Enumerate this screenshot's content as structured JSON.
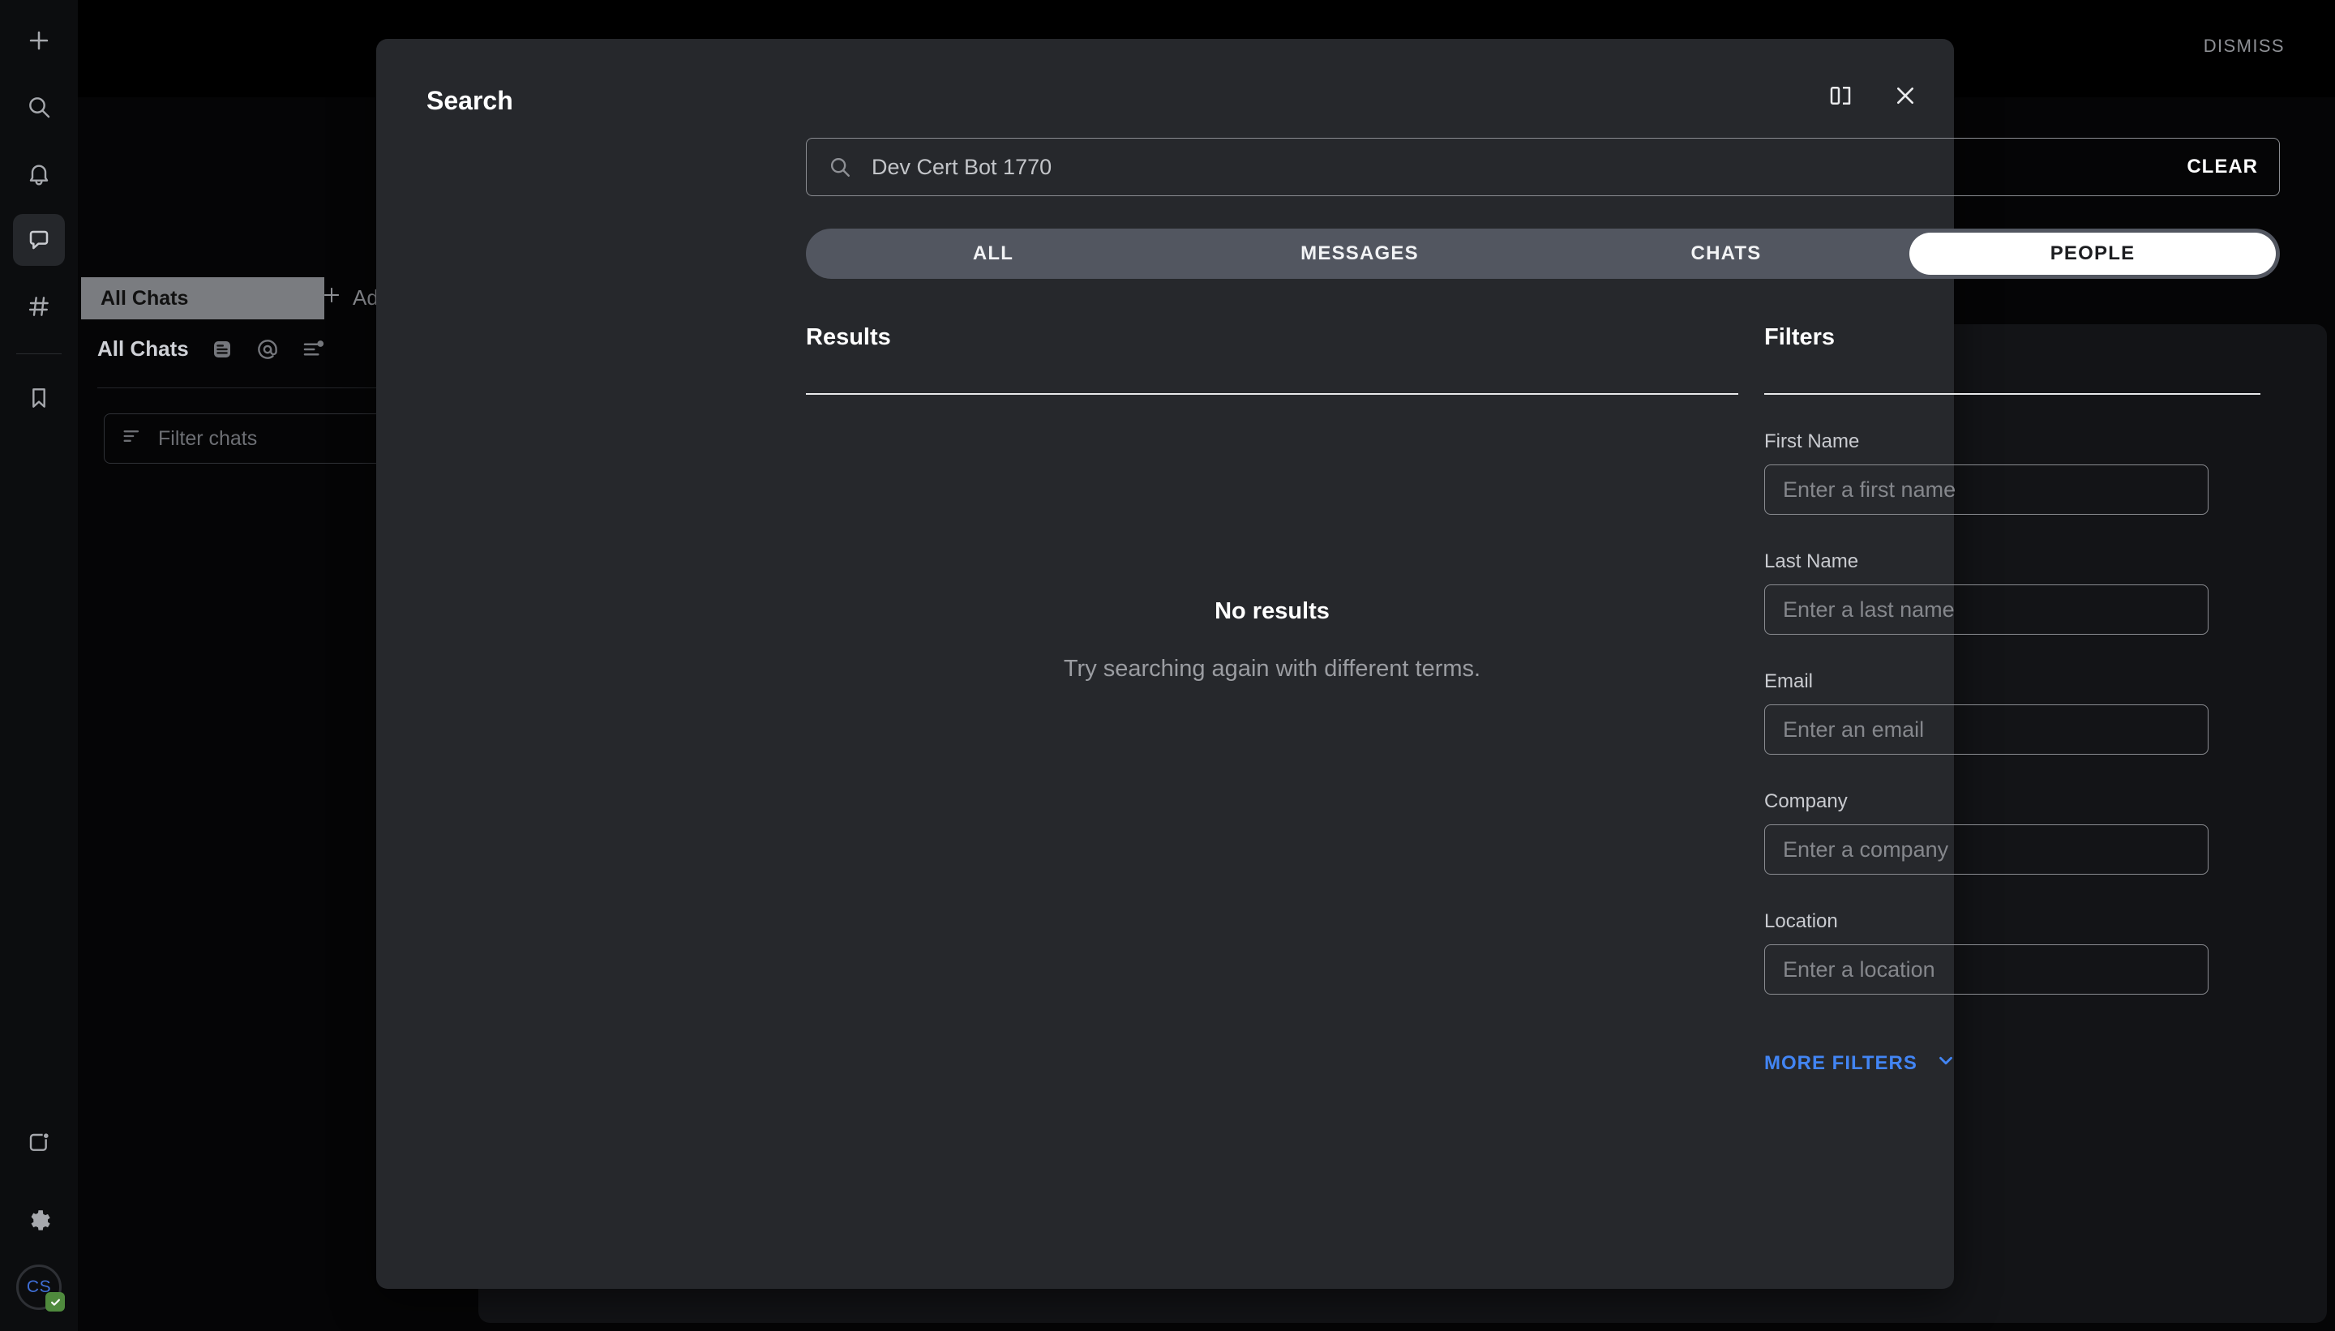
{
  "rail": {
    "items": [
      {
        "name": "plus-icon",
        "label": "New"
      },
      {
        "name": "search-icon",
        "label": "Search"
      },
      {
        "name": "bell-icon",
        "label": "Notifications"
      },
      {
        "name": "chat-icon",
        "label": "Chats"
      },
      {
        "name": "hash-icon",
        "label": "Channels"
      },
      {
        "name": "bookmark-icon",
        "label": "Saved"
      }
    ],
    "bottom": [
      {
        "name": "apps-icon",
        "label": "Apps"
      },
      {
        "name": "gear-icon",
        "label": "Settings"
      }
    ],
    "avatar": {
      "initials": "CS",
      "status": "available",
      "accent": "#3f6fd8",
      "badge_color": "#4f8a3d"
    }
  },
  "background": {
    "dismiss_label": "DISMISS",
    "active_tab": "All Chats",
    "add_label": "Ad",
    "list_header": "All Chats",
    "filter_placeholder": "Filter chats"
  },
  "dialog": {
    "title": "Search",
    "split_view_label": "Split view",
    "close_label": "Close",
    "search": {
      "value": "Dev Cert Bot 1770",
      "placeholder": "Search",
      "clear_label": "CLEAR"
    },
    "tabs": [
      {
        "label": "ALL",
        "selected": false
      },
      {
        "label": "MESSAGES",
        "selected": false
      },
      {
        "label": "CHATS",
        "selected": false
      },
      {
        "label": "PEOPLE",
        "selected": true
      }
    ],
    "results": {
      "heading": "Results",
      "empty_title": "No results",
      "empty_subtitle": "Try searching again with different terms."
    },
    "filters": {
      "heading": "Filters",
      "fields": [
        {
          "label": "First Name",
          "placeholder": "Enter a first name",
          "value": ""
        },
        {
          "label": "Last Name",
          "placeholder": "Enter a last name",
          "value": ""
        },
        {
          "label": "Email",
          "placeholder": "Enter an email",
          "value": ""
        },
        {
          "label": "Company",
          "placeholder": "Enter a company",
          "value": ""
        },
        {
          "label": "Location",
          "placeholder": "Enter a location",
          "value": ""
        }
      ],
      "more_label": "MORE FILTERS",
      "more_accent": "#4285f4"
    }
  }
}
